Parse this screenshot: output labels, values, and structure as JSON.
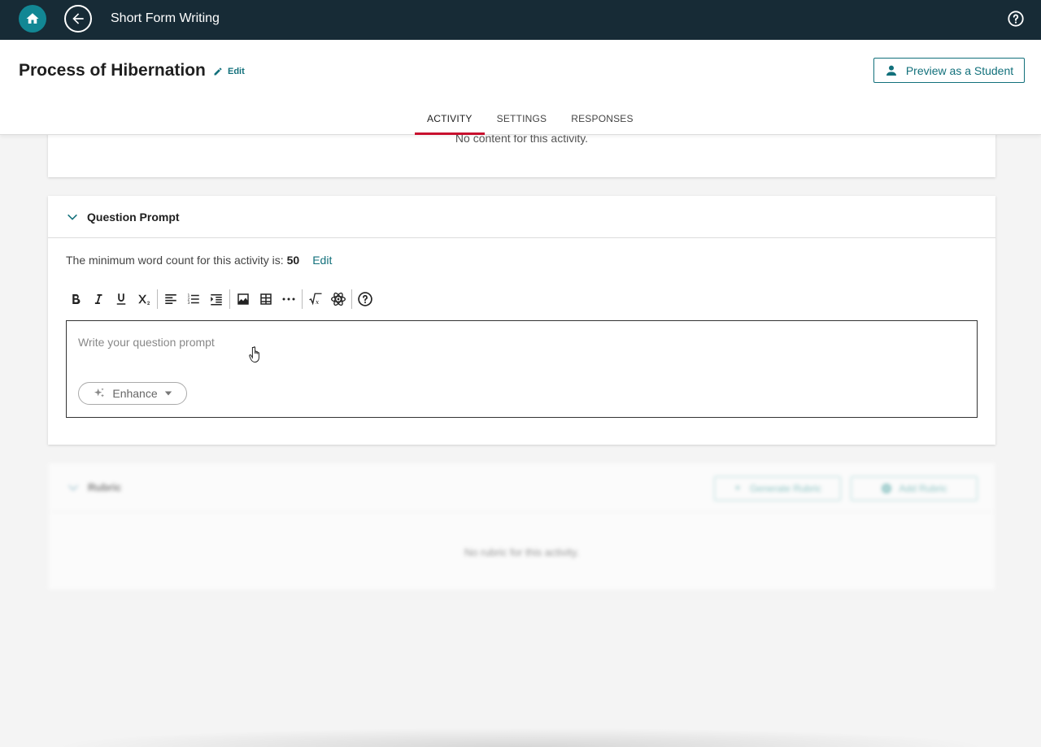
{
  "topbar": {
    "title": "Short Form Writing",
    "home_icon": "home-icon",
    "back_icon": "back-arrow-icon",
    "help_icon": "help-icon"
  },
  "header": {
    "page_title": "Process of Hibernation",
    "edit_label": "Edit",
    "preview_label": "Preview as a Student"
  },
  "tabs": [
    {
      "label": "ACTIVITY",
      "active": true
    },
    {
      "label": "SETTINGS",
      "active": false
    },
    {
      "label": "RESPONSES",
      "active": false
    }
  ],
  "content_card": {
    "message": "No content for this activity."
  },
  "question_prompt": {
    "title": "Question Prompt",
    "word_count_text": "The minimum word count for this activity is:",
    "word_count_value": "50",
    "word_count_edit": "Edit",
    "placeholder": "Write your question prompt",
    "enhance_label": "Enhance"
  },
  "rubric": {
    "title": "Rubric",
    "generate_label": "Generate Rubric",
    "add_label": "Add Rubric",
    "empty_message": "No rubric for this activity."
  },
  "colors": {
    "topbar": "#172b36",
    "accent": "#12707b",
    "tab_underline": "#c8102e"
  }
}
